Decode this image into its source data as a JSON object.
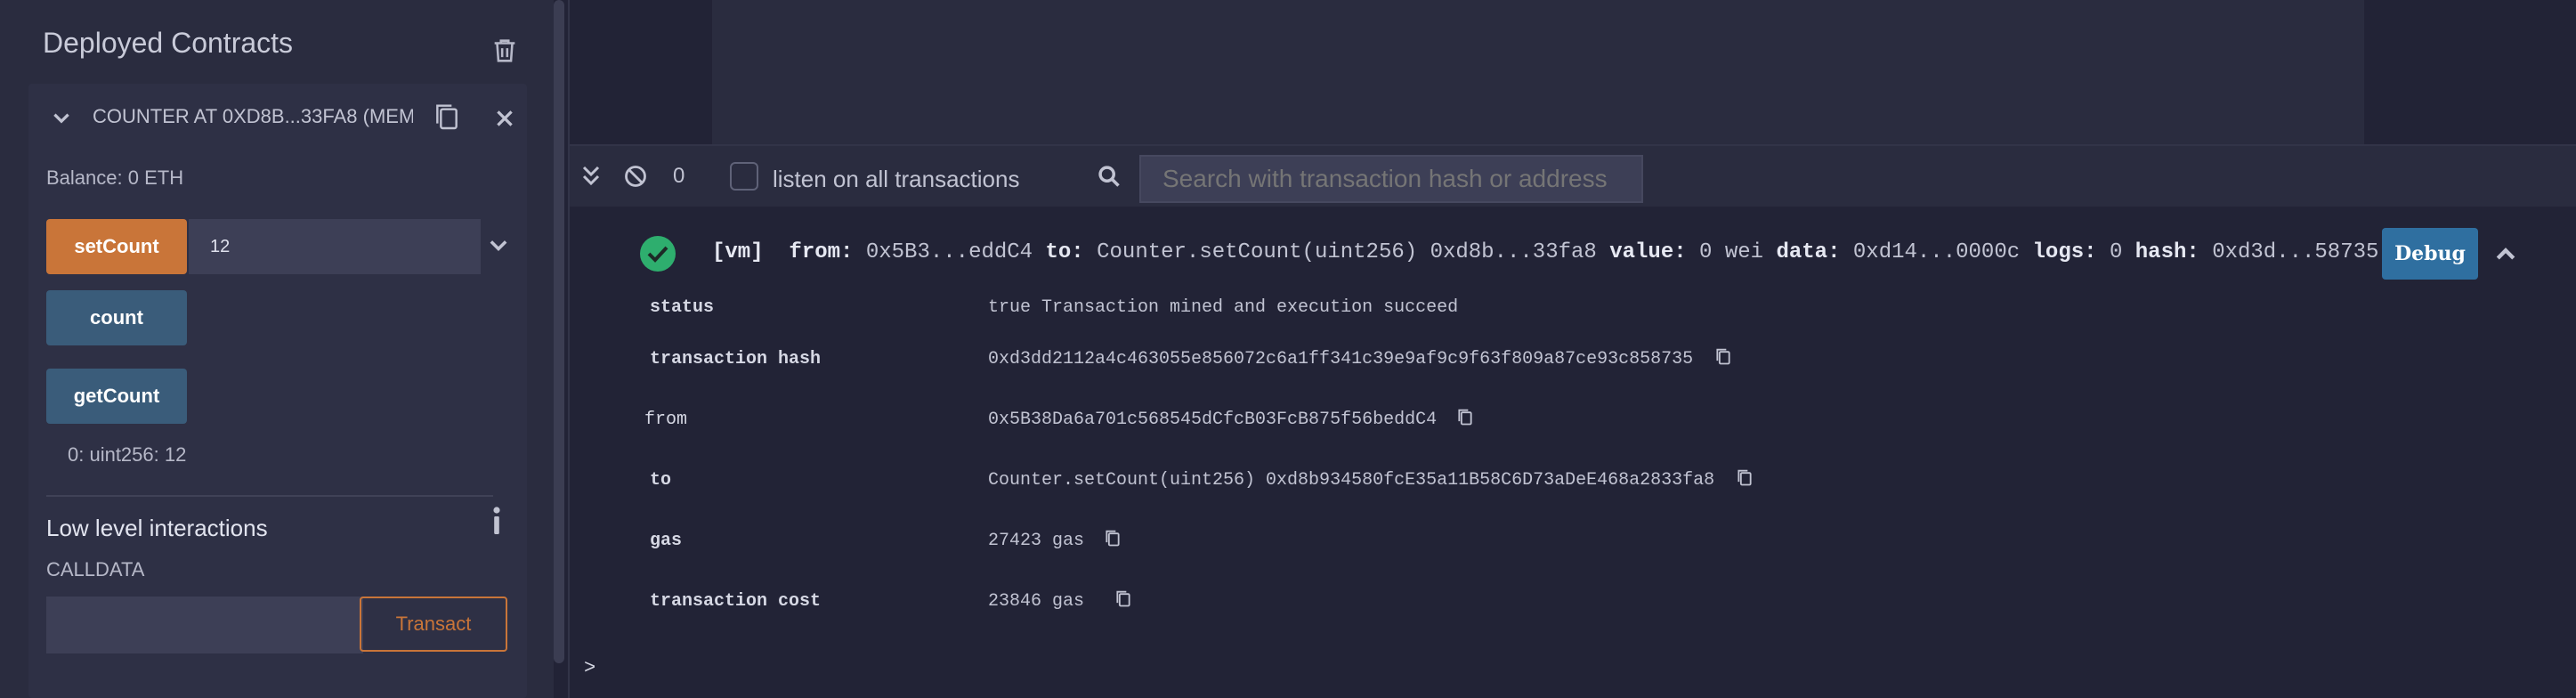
{
  "deployed_contracts": {
    "title": "Deployed Contracts",
    "instance": {
      "title": "COUNTER AT 0XD8B...33FA8 (MEM",
      "balance": "Balance: 0 ETH",
      "functions": [
        {
          "label": "setCount",
          "input_value": "12",
          "color": "#c97539"
        },
        {
          "label": "count",
          "color": "#3a5c7a"
        },
        {
          "label": "getCount",
          "color": "#3a5c7a"
        }
      ],
      "result": "0: uint256: 12",
      "low_level": {
        "title": "Low level interactions",
        "calldata_label": "CALLDATA",
        "calldata_value": "",
        "transact_label": "Transact"
      }
    }
  },
  "terminal": {
    "pending_count": "0",
    "listen_label": "listen on all transactions",
    "search_placeholder": "Search with transaction hash or address",
    "tx": {
      "vm_tag": "[vm]",
      "from_key": "from:",
      "from_val": "0x5B3...eddC4",
      "to_key": "to:",
      "to_val": "Counter.setCount(uint256) 0xd8b...33fa8",
      "value_key": "value:",
      "value_val": "0 wei",
      "data_key": "data:",
      "data_val": "0xd14...0000c",
      "logs_key": "logs:",
      "logs_val": "0",
      "hash_key": "hash:",
      "hash_val": "0xd3d...58735",
      "debug_label": "Debug"
    },
    "details": [
      {
        "label": "status",
        "value": "true Transaction mined and execution succeed"
      },
      {
        "label": "transaction hash",
        "value": "0xd3dd2112a4c463055e856072c6a1ff341c39e9af9c9f63f809a87ce93c858735"
      },
      {
        "label": "from",
        "value": "0x5B38Da6a701c568545dCfcB03FcB875f56beddC4"
      },
      {
        "label": "to",
        "value": "Counter.setCount(uint256) 0xd8b934580fcE35a11B58C6D73aDeE468a2833fa8"
      },
      {
        "label": "gas",
        "value": "27423 gas"
      },
      {
        "label": "transaction cost",
        "value": "23846 gas"
      }
    ],
    "prompt": ">"
  },
  "colors": {
    "accent_orange": "#c97539",
    "button_blue": "#3a5c7a",
    "debug_blue": "#2f6fa0",
    "success_green": "#2eae6e"
  }
}
